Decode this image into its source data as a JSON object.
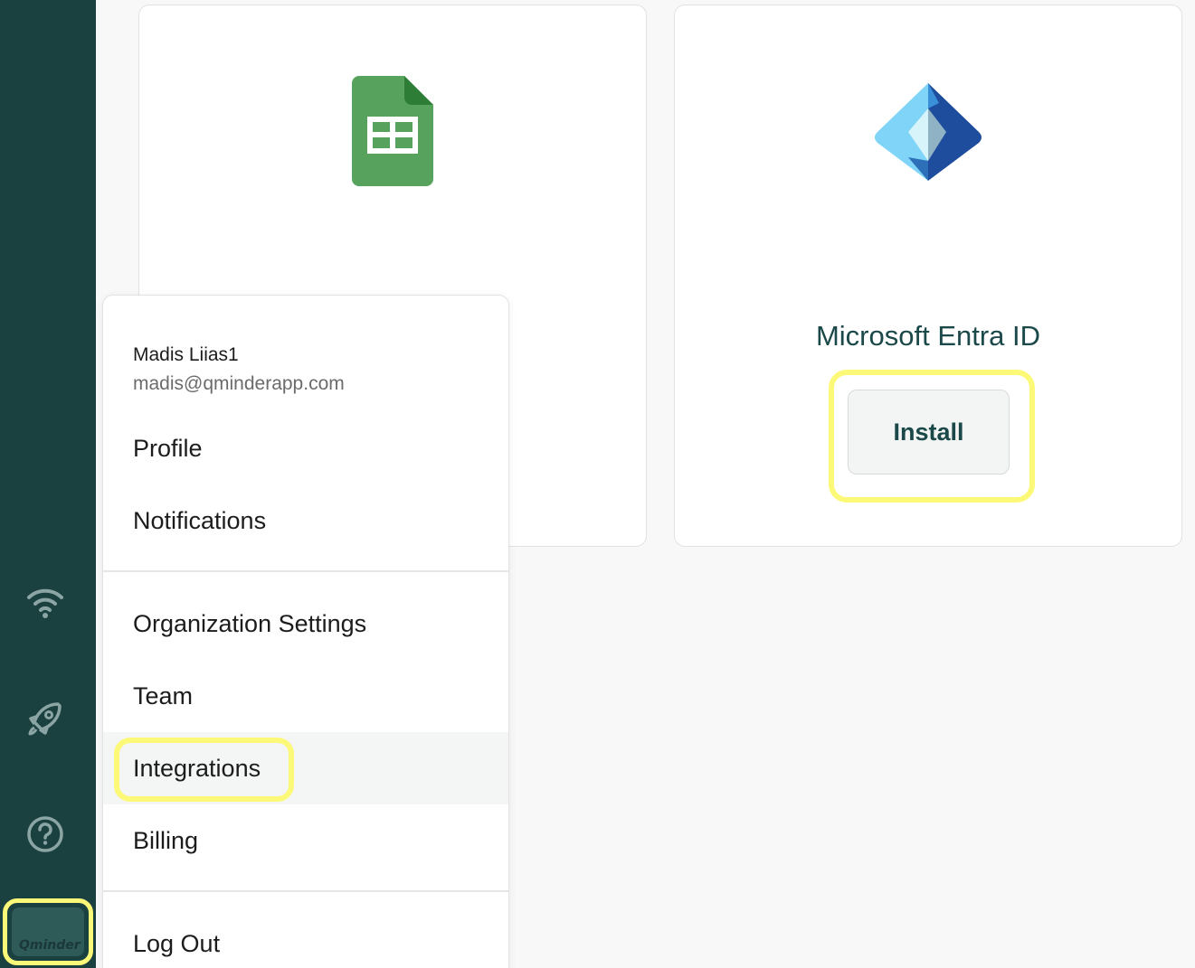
{
  "brand": {
    "logo_text": "Qminder",
    "sidebar_color": "#1b4040",
    "accent_color": "#1b4848",
    "highlight_color": "#fdf978"
  },
  "sidebar": {
    "icons": [
      "wifi-icon",
      "rocket-icon",
      "help-icon"
    ]
  },
  "integrations": {
    "cards": [
      {
        "icon": "google-sheets-icon",
        "title": "",
        "button": ""
      },
      {
        "icon": "microsoft-entra-icon",
        "title": "Microsoft Entra ID",
        "button": "Install"
      }
    ]
  },
  "user_menu": {
    "name": "Madis Liias1",
    "email": "madis@qminderapp.com",
    "items": [
      {
        "label": "Profile"
      },
      {
        "label": "Notifications"
      },
      {
        "label": "Organization Settings"
      },
      {
        "label": "Team"
      },
      {
        "label": "Integrations",
        "active": true
      },
      {
        "label": "Billing"
      },
      {
        "label": "Log Out"
      }
    ]
  }
}
